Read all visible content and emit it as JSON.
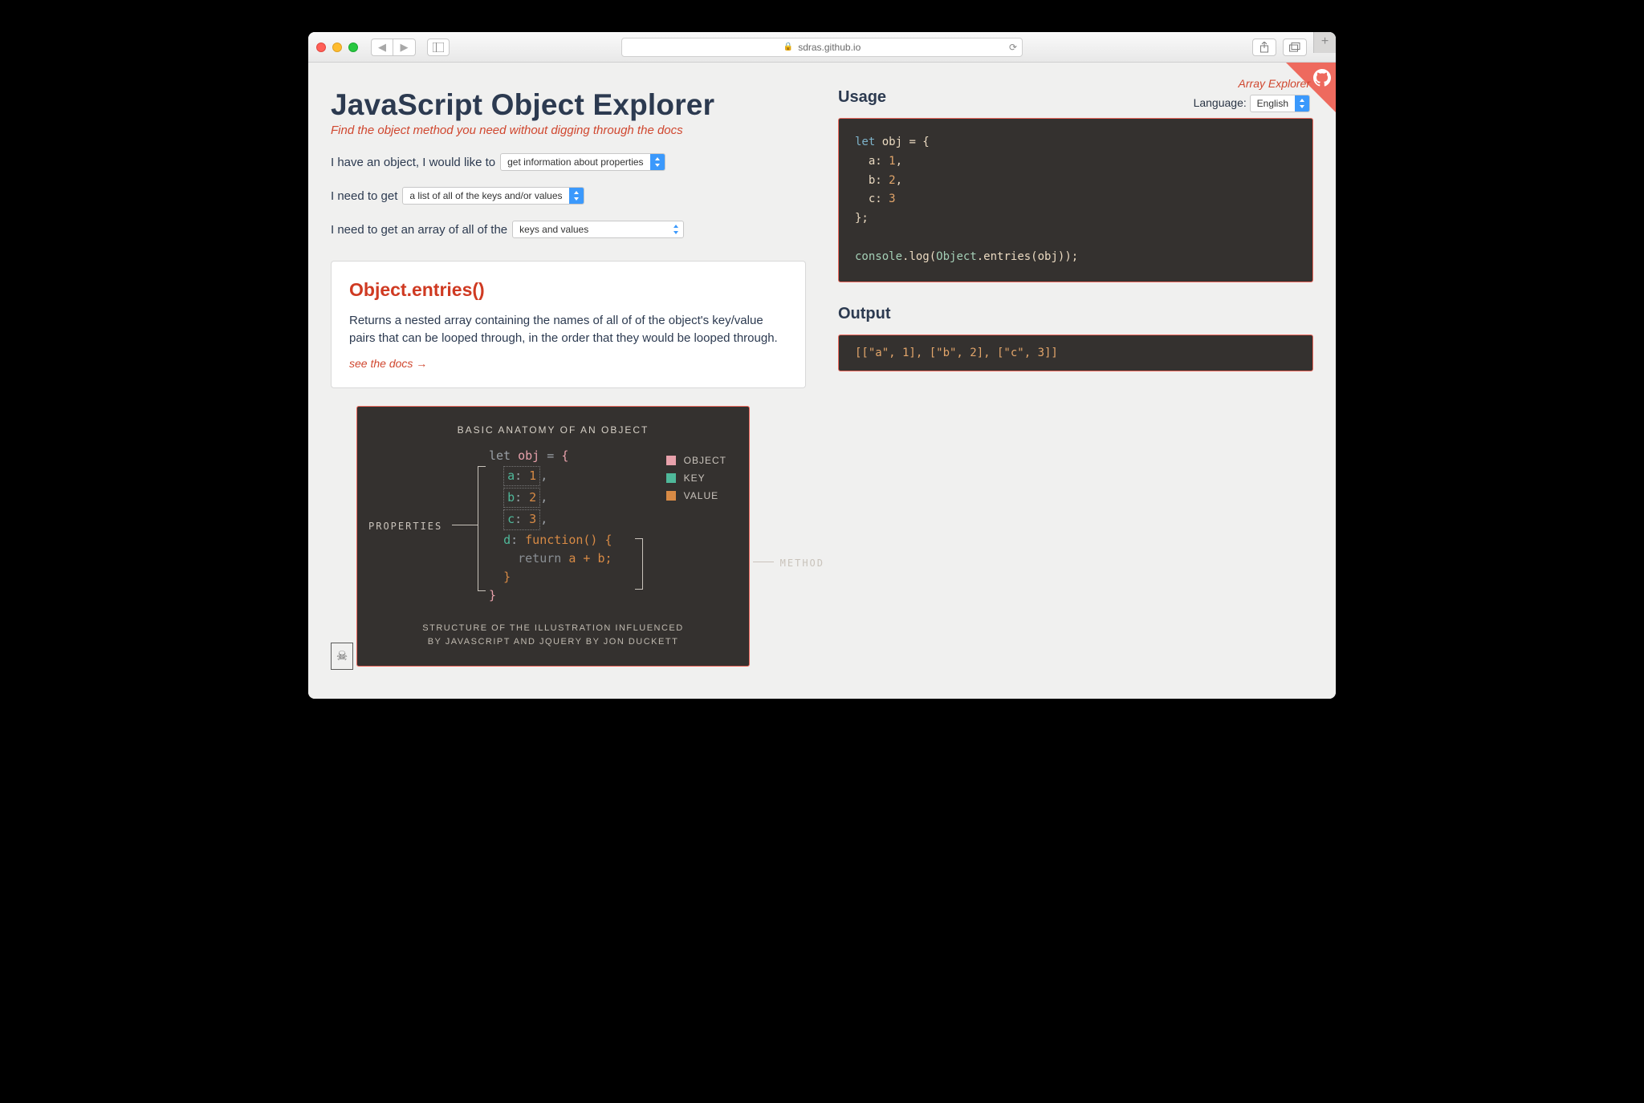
{
  "browser": {
    "url_host": "sdras.github.io"
  },
  "top": {
    "array_explorer": "Array Explorer",
    "language_label": "Language:",
    "language_value": "English"
  },
  "header": {
    "title": "JavaScript Object Explorer",
    "subtitle": "Find the object method you need without digging through the docs"
  },
  "prompts": {
    "line1_text": "I have an object, I would like to",
    "line1_select": "get information about properties",
    "line2_text": "I need to get",
    "line2_select": "a list of all of the keys and/or values",
    "line3_text": "I need to get an array of all of the",
    "line3_select": "keys and values"
  },
  "result": {
    "method": "Object.entries()",
    "description": "Returns a nested array containing the names of all of of the object's key/value pairs that can be looped through, in the order that they would be looped through.",
    "docs_link": "see the docs →"
  },
  "usage": {
    "heading": "Usage",
    "code_plain": "let obj = {\n  a: 1,\n  b: 2,\n  c: 3\n};\n\nconsole.log(Object.entries(obj));"
  },
  "output": {
    "heading": "Output",
    "text": "[[\"a\", 1], [\"b\", 2], [\"c\", 3]]"
  },
  "anatomy": {
    "caption": "BASIC ANATOMY OF AN OBJECT",
    "legend": {
      "object": "OBJECT",
      "key": "KEY",
      "value": "VALUE"
    },
    "labels": {
      "properties": "PROPERTIES",
      "method": "METHOD"
    },
    "code": {
      "l1": "let obj = {",
      "rows": [
        {
          "k": "a",
          "v": "1"
        },
        {
          "k": "b",
          "v": "2"
        },
        {
          "k": "c",
          "v": "3"
        }
      ],
      "fn_key": "d",
      "fn_sig": "function() {",
      "fn_body": "return a + b;",
      "fn_close": "}",
      "obj_close": "}"
    },
    "credit_l1": "STRUCTURE OF THE ILLUSTRATION INFLUENCED",
    "credit_l2": "BY JAVASCRIPT AND JQUERY BY JON DUCKETT"
  }
}
